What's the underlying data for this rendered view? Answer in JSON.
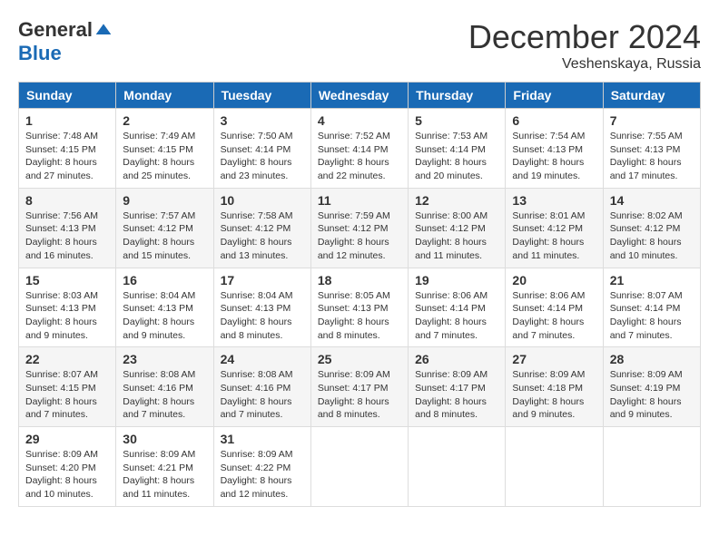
{
  "header": {
    "logo_general": "General",
    "logo_blue": "Blue",
    "month_title": "December 2024",
    "location": "Veshenskaya, Russia"
  },
  "days_of_week": [
    "Sunday",
    "Monday",
    "Tuesday",
    "Wednesday",
    "Thursday",
    "Friday",
    "Saturday"
  ],
  "weeks": [
    [
      {
        "day": "1",
        "sunrise": "7:48 AM",
        "sunset": "4:15 PM",
        "daylight": "8 hours and 27 minutes."
      },
      {
        "day": "2",
        "sunrise": "7:49 AM",
        "sunset": "4:15 PM",
        "daylight": "8 hours and 25 minutes."
      },
      {
        "day": "3",
        "sunrise": "7:50 AM",
        "sunset": "4:14 PM",
        "daylight": "8 hours and 23 minutes."
      },
      {
        "day": "4",
        "sunrise": "7:52 AM",
        "sunset": "4:14 PM",
        "daylight": "8 hours and 22 minutes."
      },
      {
        "day": "5",
        "sunrise": "7:53 AM",
        "sunset": "4:14 PM",
        "daylight": "8 hours and 20 minutes."
      },
      {
        "day": "6",
        "sunrise": "7:54 AM",
        "sunset": "4:13 PM",
        "daylight": "8 hours and 19 minutes."
      },
      {
        "day": "7",
        "sunrise": "7:55 AM",
        "sunset": "4:13 PM",
        "daylight": "8 hours and 17 minutes."
      }
    ],
    [
      {
        "day": "8",
        "sunrise": "7:56 AM",
        "sunset": "4:13 PM",
        "daylight": "8 hours and 16 minutes."
      },
      {
        "day": "9",
        "sunrise": "7:57 AM",
        "sunset": "4:12 PM",
        "daylight": "8 hours and 15 minutes."
      },
      {
        "day": "10",
        "sunrise": "7:58 AM",
        "sunset": "4:12 PM",
        "daylight": "8 hours and 13 minutes."
      },
      {
        "day": "11",
        "sunrise": "7:59 AM",
        "sunset": "4:12 PM",
        "daylight": "8 hours and 12 minutes."
      },
      {
        "day": "12",
        "sunrise": "8:00 AM",
        "sunset": "4:12 PM",
        "daylight": "8 hours and 11 minutes."
      },
      {
        "day": "13",
        "sunrise": "8:01 AM",
        "sunset": "4:12 PM",
        "daylight": "8 hours and 11 minutes."
      },
      {
        "day": "14",
        "sunrise": "8:02 AM",
        "sunset": "4:12 PM",
        "daylight": "8 hours and 10 minutes."
      }
    ],
    [
      {
        "day": "15",
        "sunrise": "8:03 AM",
        "sunset": "4:13 PM",
        "daylight": "8 hours and 9 minutes."
      },
      {
        "day": "16",
        "sunrise": "8:04 AM",
        "sunset": "4:13 PM",
        "daylight": "8 hours and 9 minutes."
      },
      {
        "day": "17",
        "sunrise": "8:04 AM",
        "sunset": "4:13 PM",
        "daylight": "8 hours and 8 minutes."
      },
      {
        "day": "18",
        "sunrise": "8:05 AM",
        "sunset": "4:13 PM",
        "daylight": "8 hours and 8 minutes."
      },
      {
        "day": "19",
        "sunrise": "8:06 AM",
        "sunset": "4:14 PM",
        "daylight": "8 hours and 7 minutes."
      },
      {
        "day": "20",
        "sunrise": "8:06 AM",
        "sunset": "4:14 PM",
        "daylight": "8 hours and 7 minutes."
      },
      {
        "day": "21",
        "sunrise": "8:07 AM",
        "sunset": "4:14 PM",
        "daylight": "8 hours and 7 minutes."
      }
    ],
    [
      {
        "day": "22",
        "sunrise": "8:07 AM",
        "sunset": "4:15 PM",
        "daylight": "8 hours and 7 minutes."
      },
      {
        "day": "23",
        "sunrise": "8:08 AM",
        "sunset": "4:16 PM",
        "daylight": "8 hours and 7 minutes."
      },
      {
        "day": "24",
        "sunrise": "8:08 AM",
        "sunset": "4:16 PM",
        "daylight": "8 hours and 7 minutes."
      },
      {
        "day": "25",
        "sunrise": "8:09 AM",
        "sunset": "4:17 PM",
        "daylight": "8 hours and 8 minutes."
      },
      {
        "day": "26",
        "sunrise": "8:09 AM",
        "sunset": "4:17 PM",
        "daylight": "8 hours and 8 minutes."
      },
      {
        "day": "27",
        "sunrise": "8:09 AM",
        "sunset": "4:18 PM",
        "daylight": "8 hours and 9 minutes."
      },
      {
        "day": "28",
        "sunrise": "8:09 AM",
        "sunset": "4:19 PM",
        "daylight": "8 hours and 9 minutes."
      }
    ],
    [
      {
        "day": "29",
        "sunrise": "8:09 AM",
        "sunset": "4:20 PM",
        "daylight": "8 hours and 10 minutes."
      },
      {
        "day": "30",
        "sunrise": "8:09 AM",
        "sunset": "4:21 PM",
        "daylight": "8 hours and 11 minutes."
      },
      {
        "day": "31",
        "sunrise": "8:09 AM",
        "sunset": "4:22 PM",
        "daylight": "8 hours and 12 minutes."
      },
      null,
      null,
      null,
      null
    ]
  ],
  "labels": {
    "sunrise": "Sunrise:",
    "sunset": "Sunset:",
    "daylight": "Daylight:"
  }
}
